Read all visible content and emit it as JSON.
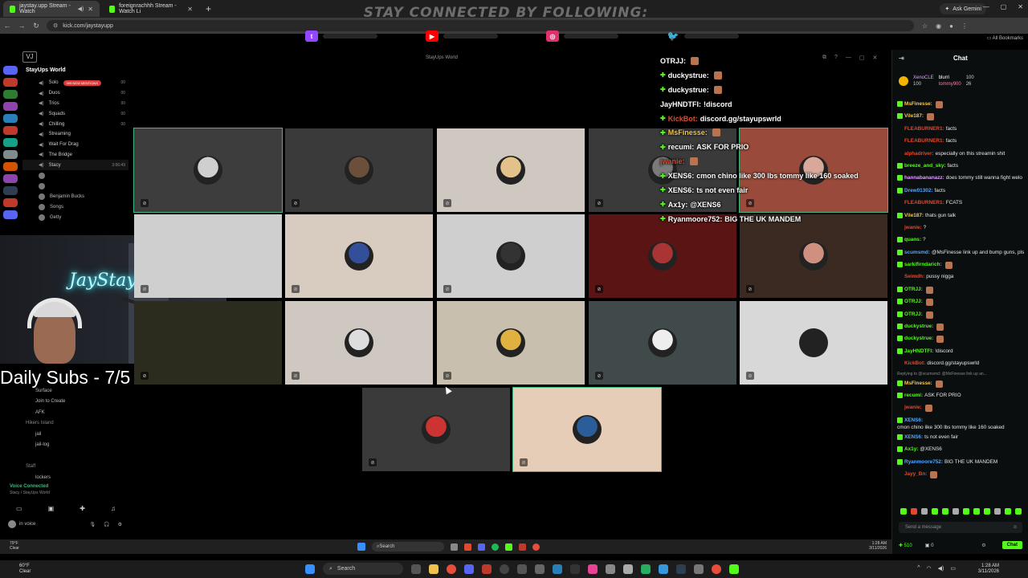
{
  "browser": {
    "tabs": [
      {
        "label": "jaystay.upp Stream - Watch",
        "active": true
      },
      {
        "label": "foreignrachhh Stream - Watch Li",
        "active": false
      }
    ],
    "url": "kick.com/jaystayupp",
    "gemini_label": "Ask Gemini",
    "bookmarks_label": "All Bookmarks"
  },
  "overlay": {
    "banner": "STAY CONNECTED BY FOLLOWING:",
    "socials": [
      {
        "icon": "twitch-icon",
        "color": "#9146ff"
      },
      {
        "icon": "youtube-icon",
        "color": "#ff0000"
      },
      {
        "icon": "instagram-icon",
        "color": "#e1306c"
      },
      {
        "icon": "twitter-icon",
        "color": "#1da1f2"
      }
    ],
    "vj_label": "VJ",
    "room_title": "StayUps World",
    "webcam_sign": "JayStayUp",
    "daily_subs": "Daily Subs - 7/5"
  },
  "discord": {
    "server_name": "StayUps World",
    "channels": [
      {
        "name": "Solo",
        "badge": "999 NEW MENTIONS",
        "count": "00"
      },
      {
        "name": "Duos",
        "count": "00"
      },
      {
        "name": "Trios",
        "count": "00"
      },
      {
        "name": "Squads",
        "count": "00"
      },
      {
        "name": "Chilling",
        "count": "00"
      },
      {
        "name": "Streaming",
        "count": ""
      },
      {
        "name": "Wait For Drag",
        "count": ""
      },
      {
        "name": "The Bridge",
        "count": ""
      },
      {
        "name": "Stacy",
        "count": "3:56:49",
        "selected": true
      }
    ],
    "members": [
      "Benjamin Bucks",
      "Songs",
      "Getty"
    ],
    "lower_items": [
      "Surface",
      "Join to Create",
      "AFK",
      "Hikers Island",
      "jail",
      "jail-log",
      "Staff",
      "lockers"
    ],
    "voice_connected": "Voice Connected",
    "voice_channel": "Stacy / StayUps World",
    "user_label": "in voice"
  },
  "overlay_chat": [
    {
      "user": "OTRJJ:",
      "msg": "",
      "color": "#ffffff",
      "badge": false
    },
    {
      "user": "duckystrue:",
      "msg": "",
      "color": "#ffffff",
      "badge": true
    },
    {
      "user": "duckystrue:",
      "msg": "",
      "color": "#ffffff",
      "badge": true
    },
    {
      "user": "JayHNDTFI:",
      "msg": "!discord",
      "color": "#ffffff",
      "badge": false
    },
    {
      "user": "KickBot:",
      "msg": "discord.gg/stayupswrld",
      "color": "#e0492e",
      "badge": true
    },
    {
      "user": "MsFinesse:",
      "msg": "",
      "color": "#f3c94b",
      "badge": true
    },
    {
      "user": "recumi:",
      "msg": "ASK FOR PRIO",
      "color": "#ffffff",
      "badge": true
    },
    {
      "user": "jwanie:",
      "msg": "",
      "color": "#e0492e",
      "badge": false
    },
    {
      "user": "XENS6:",
      "msg": "cmon chino like 300 lbs tommy like 160 soaked",
      "color": "#ffffff",
      "badge": true
    },
    {
      "user": "XENS6:",
      "msg": "ts not even fair",
      "color": "#ffffff",
      "badge": true
    },
    {
      "user": "Ax1y:",
      "msg": "@XENS6",
      "color": "#ffffff",
      "badge": true
    },
    {
      "user": "Ryanmoore752:",
      "msg": "BIG THE UK MANDEM",
      "color": "#ffffff",
      "badge": true
    }
  ],
  "chat": {
    "header": "Chat",
    "pinned": [
      {
        "name": "XenoCLE",
        "value": "100"
      },
      {
        "name": "blurri",
        "value": "100"
      },
      {
        "name": "tommy900",
        "value": "26"
      }
    ],
    "messages": [
      {
        "user": "MsFinesse:",
        "msg": "",
        "color": "#f3c94b"
      },
      {
        "user": "Vile187:",
        "msg": "",
        "color": "#f3c94b"
      },
      {
        "user": "FLEABURNER1:",
        "msg": "facts",
        "color": "#e0492e"
      },
      {
        "user": "FLEABURNER1:",
        "msg": "facts",
        "color": "#e0492e"
      },
      {
        "user": "alphadriver:",
        "msg": "especially on this streamin shit",
        "color": "#e0492e"
      },
      {
        "user": "breeze_and_sky:",
        "msg": "facts",
        "color": "#53fc18"
      },
      {
        "user": "hannabananazz:",
        "msg": "does tommy still wanna fight welo",
        "color": "#e0a0ff"
      },
      {
        "user": "Drew01302:",
        "msg": "facts",
        "color": "#53a8fc"
      },
      {
        "user": "FLEABURNER1:",
        "msg": "FCATS",
        "color": "#e0492e"
      },
      {
        "user": "Vile187:",
        "msg": "thats gun talk",
        "color": "#f3c94b"
      },
      {
        "user": "jwanie:",
        "msg": "?",
        "color": "#e0492e"
      },
      {
        "user": "quans:",
        "msg": "?",
        "color": "#53fc18"
      },
      {
        "user": "scumsmd:",
        "msg": "@MsFinesse link up and bump guns, pls",
        "color": "#53a8fc"
      },
      {
        "user": "sarkifirndarich:",
        "msg": "",
        "color": "#53fc18"
      },
      {
        "user": "Seimdh:",
        "msg": "pussy nigga",
        "color": "#e0492e"
      },
      {
        "user": "OTRJJ:",
        "msg": "",
        "color": "#53fc18"
      },
      {
        "user": "OTRJJ:",
        "msg": "",
        "color": "#53fc18"
      },
      {
        "user": "OTRJJ:",
        "msg": "",
        "color": "#53fc18"
      },
      {
        "user": "duckystrue:",
        "msg": "",
        "color": "#53fc18"
      },
      {
        "user": "duckystrue:",
        "msg": "",
        "color": "#53fc18"
      },
      {
        "user": "JayHNDTFI:",
        "msg": "!discord",
        "color": "#53fc18"
      },
      {
        "user": "KickBot:",
        "msg": "discord.gg/stayupswrld",
        "color": "#e0492e"
      },
      {
        "user": "MsFinesse:",
        "msg": "",
        "color": "#f3c94b",
        "reply": "Replying to @scumsmd: @MsFinesse link up an..."
      },
      {
        "user": "recumi:",
        "msg": "ASK FOR PRIO",
        "color": "#53fc18"
      },
      {
        "user": "jwanie:",
        "msg": "",
        "color": "#e0492e"
      },
      {
        "user": "XENS6:",
        "msg": "cmon chino like 300 lbs tommy like 160 soaked",
        "color": "#53a8fc"
      },
      {
        "user": "XENS6:",
        "msg": "ts not even fair",
        "color": "#53a8fc"
      },
      {
        "user": "Ax1y:",
        "msg": "@XENS6",
        "color": "#53fc18"
      },
      {
        "user": "Ryanmoore752:",
        "msg": "BIG THE UK MANDEM",
        "color": "#53a8fc"
      },
      {
        "user": "Jayy_Bn:",
        "msg": "",
        "color": "#e0492e"
      }
    ],
    "input_placeholder": "Send a message",
    "points": "510",
    "footer_count": "0",
    "chat_button": "Chat"
  },
  "inner_taskbar": {
    "search": "Search",
    "weather_temp": "79°F",
    "weather_desc": "Clear",
    "time": "1:28 AM",
    "date": "3/11/2026"
  },
  "taskbar": {
    "weather_temp": "60°F",
    "weather_desc": "Clear",
    "search": "Search",
    "time": "1:28 AM",
    "date": "3/11/2026"
  }
}
